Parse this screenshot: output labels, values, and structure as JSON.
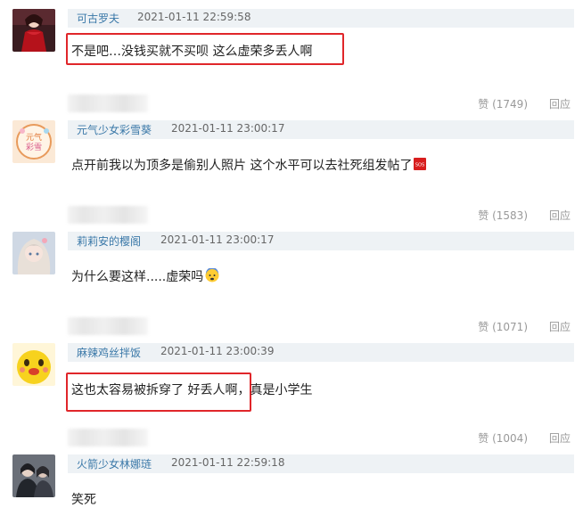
{
  "comments": [
    {
      "username": "可古罗夫",
      "time": "2021-01-11 22:59:58",
      "text": "不是吧…没钱买就不买呗 这么虚荣多丢人啊",
      "highlighted": true,
      "like_label": "赞",
      "like_count": "(1749)",
      "reply_label": "回应",
      "avatar_icon": "girl-red-dress-avatar"
    },
    {
      "username": "元气少女彩雪葵",
      "time": "2021-01-11 23:00:17",
      "text": "点开前我以为顶多是偷别人照片 这个水平可以去社死组发帖了",
      "emoji": "sos-emoji",
      "highlighted": false,
      "like_label": "赞",
      "like_count": "(1583)",
      "reply_label": "回应",
      "avatar_icon": "cartoon-badge-avatar"
    },
    {
      "username": "莉莉安的樱阁",
      "time": "2021-01-11 23:00:17",
      "text": "为什么要这样.....虚荣吗",
      "emoji": "anxious-face-emoji",
      "highlighted": false,
      "like_label": "赞",
      "like_count": "(1071)",
      "reply_label": "回应",
      "avatar_icon": "anime-girl-avatar"
    },
    {
      "username": "麻辣鸡丝拌饭",
      "time": "2021-01-11 23:00:39",
      "text": "这也太容易被拆穿了 好丢人啊，真是小学生",
      "highlighted": true,
      "like_label": "赞",
      "like_count": "(1004)",
      "reply_label": "回应",
      "avatar_icon": "yellow-chick-avatar"
    },
    {
      "username": "火箭少女林娜琏",
      "time": "2021-01-11 22:59:18",
      "text": "笑死",
      "highlighted": false,
      "avatar_icon": "photo-people-avatar"
    }
  ],
  "colors": {
    "username": "#3a78a8",
    "header_bg": "#eef2f5",
    "highlight_border": "#e0262a"
  }
}
